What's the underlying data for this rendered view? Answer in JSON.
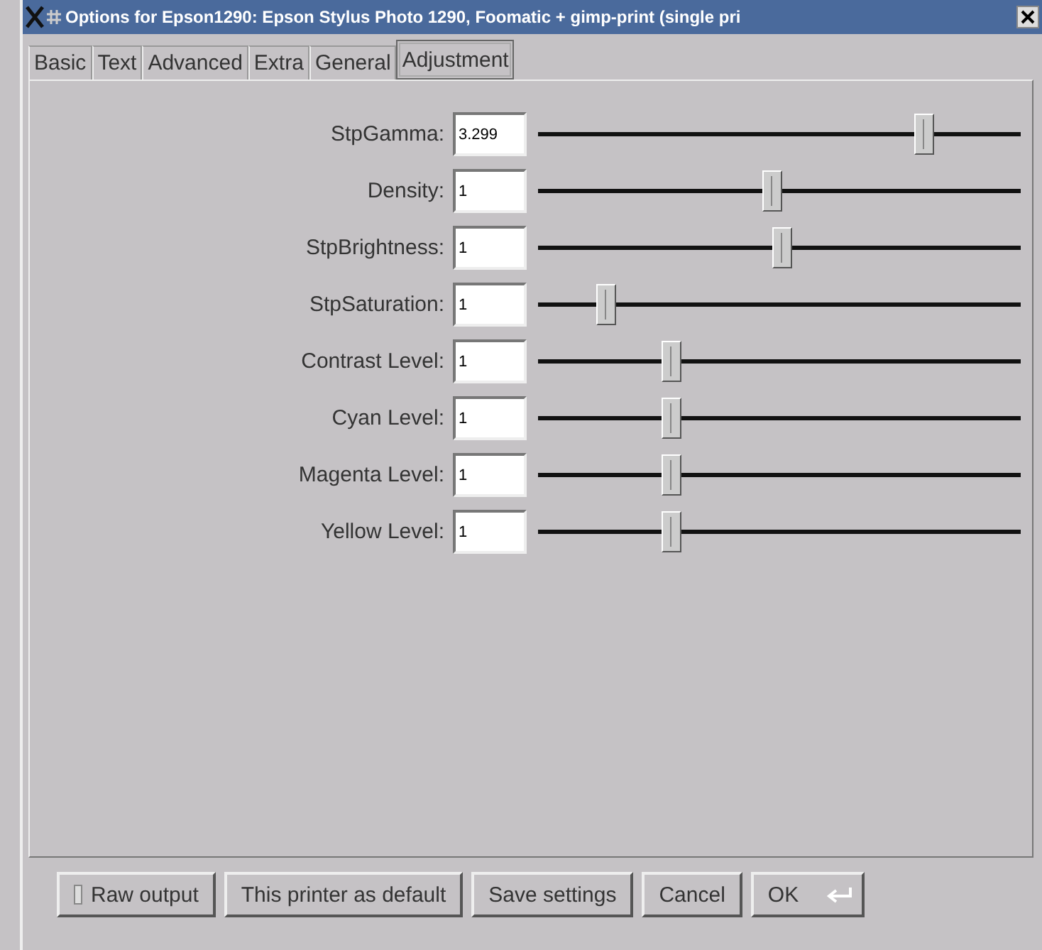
{
  "window": {
    "title": "Options for Epson1290: Epson Stylus Photo 1290, Foomatic + gimp-print (single pri"
  },
  "tabs": [
    {
      "label": "Basic",
      "selected": false
    },
    {
      "label": "Text",
      "selected": false
    },
    {
      "label": "Advanced",
      "selected": false
    },
    {
      "label": "Extra",
      "selected": false
    },
    {
      "label": "General",
      "selected": false
    },
    {
      "label": "Adjustment",
      "selected": true
    }
  ],
  "options": [
    {
      "label": "StpGamma:",
      "value": "3.299",
      "level": 0.8
    },
    {
      "label": "Density:",
      "value": "1",
      "level": 0.485
    },
    {
      "label": "StpBrightness:",
      "value": "1",
      "level": 0.505
    },
    {
      "label": "StpSaturation:",
      "value": "1",
      "level": 0.14
    },
    {
      "label": "Contrast Level:",
      "value": "1",
      "level": 0.276
    },
    {
      "label": "Cyan Level:",
      "value": "1",
      "level": 0.276
    },
    {
      "label": "Magenta Level:",
      "value": "1",
      "level": 0.276
    },
    {
      "label": "Yellow Level:",
      "value": "1",
      "level": 0.276
    }
  ],
  "raw_output": {
    "label": "Raw output",
    "checked": false
  },
  "buttons": [
    {
      "label": "This printer as default",
      "kind": "plain"
    },
    {
      "label": "Save settings",
      "kind": "plain"
    },
    {
      "label": "Cancel",
      "kind": "plain"
    },
    {
      "label": "OK",
      "kind": "default"
    }
  ]
}
